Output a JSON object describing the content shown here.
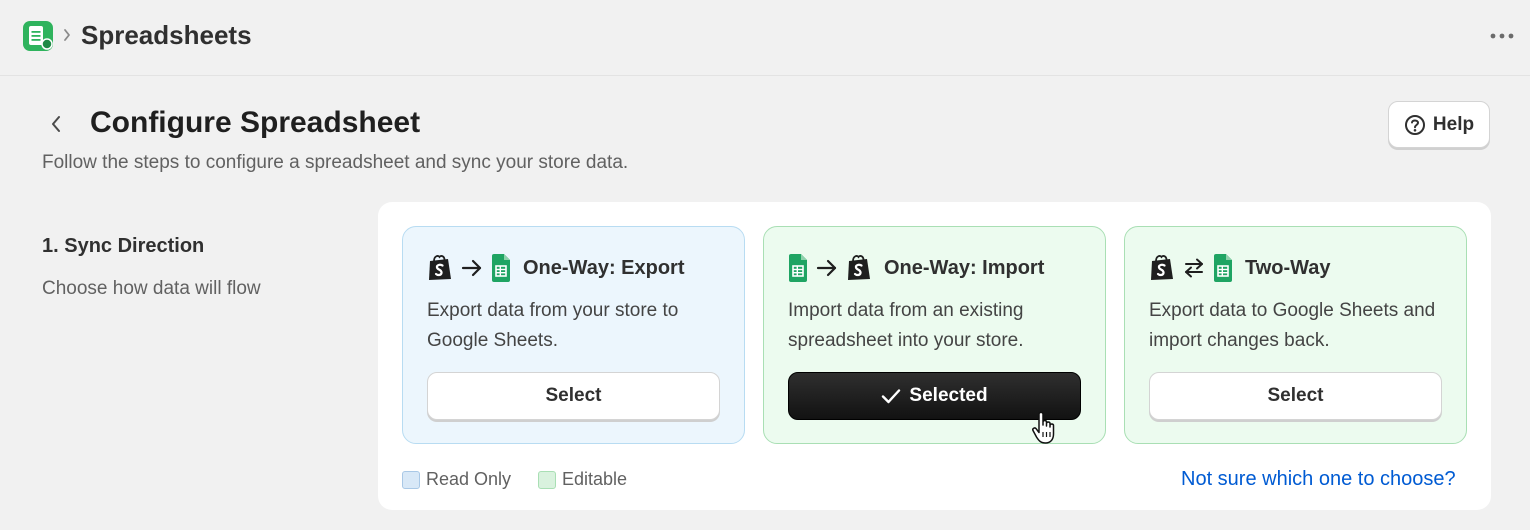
{
  "header": {
    "breadcrumb_title": "Spreadsheets",
    "app_icon": "spreadsheet-app-icon",
    "more_icon": "more-horizontal-icon"
  },
  "page": {
    "title": "Configure Spreadsheet",
    "subtitle": "Follow the steps to configure a spreadsheet and sync your store data.",
    "help_label": "Help"
  },
  "section": {
    "title": "1. Sync Direction",
    "description": "Choose how data will flow"
  },
  "cards": [
    {
      "title": "One-Way: Export",
      "description": "Export data from your store to Google Sheets.",
      "button_label": "Select",
      "selected": false,
      "icons": [
        "shopify-bag-icon",
        "arrow-right-icon",
        "google-sheets-icon"
      ]
    },
    {
      "title": "One-Way: Import",
      "description": "Import data from an existing spreadsheet into your store.",
      "button_label": "Selected",
      "selected": true,
      "icons": [
        "google-sheets-icon",
        "arrow-right-icon",
        "shopify-bag-icon"
      ]
    },
    {
      "title": "Two-Way",
      "description": "Export data to Google Sheets and import changes back.",
      "button_label": "Select",
      "selected": false,
      "icons": [
        "shopify-bag-icon",
        "arrows-swap-icon",
        "google-sheets-icon"
      ]
    }
  ],
  "legend": {
    "read_only": "Read Only",
    "editable": "Editable"
  },
  "help_link": "Not sure which one to choose?",
  "colors": {
    "export_card_bg": "#ecf6fd",
    "import_card_bg": "#ecfbef",
    "selected_button": "#1a1a1a",
    "link": "#005bd3"
  }
}
